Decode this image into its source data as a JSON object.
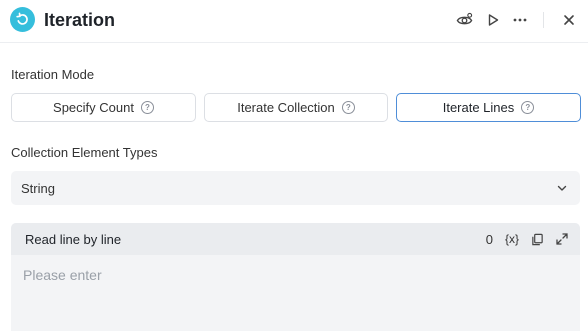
{
  "header": {
    "title": "Iteration",
    "icons": [
      "refresh-node-icon",
      "eye-settings-icon",
      "play-icon",
      "more-icon",
      "close-icon"
    ],
    "accent_color": "#35bedc"
  },
  "iteration_mode": {
    "label": "Iteration Mode",
    "options": [
      {
        "label": "Specify Count",
        "active": false
      },
      {
        "label": "Iterate Collection",
        "active": false
      },
      {
        "label": "Iterate Lines",
        "active": true
      }
    ],
    "active_color": "#4f8ed8"
  },
  "element_types": {
    "label": "Collection Element Types",
    "selected": "String"
  },
  "editor": {
    "title": "Read line by line",
    "count": "0",
    "variable_icon_text": "{x}",
    "placeholder": "Please enter",
    "value": ""
  }
}
